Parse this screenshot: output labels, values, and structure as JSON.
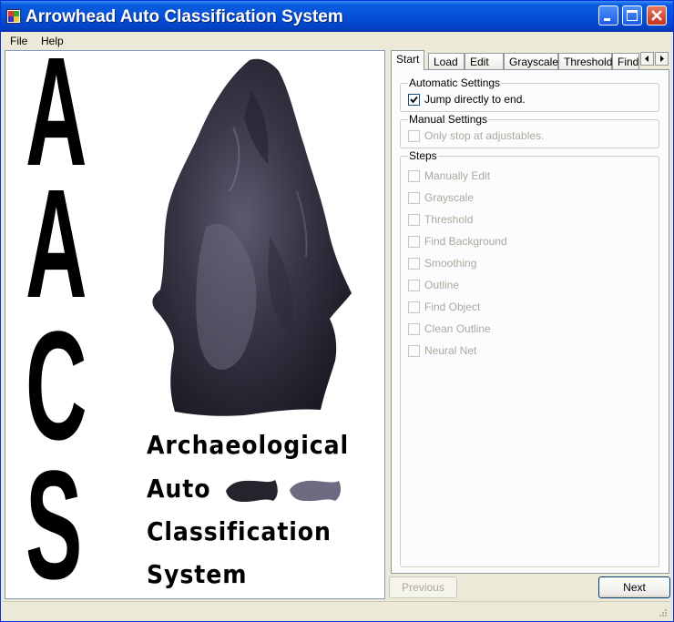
{
  "window": {
    "title": "Arrowhead Auto Classification System",
    "accent": "#0a5de0"
  },
  "menu": {
    "items": [
      {
        "label": "File"
      },
      {
        "label": "Help"
      }
    ]
  },
  "logo": {
    "letters": [
      "A",
      "A",
      "C",
      "S"
    ],
    "lines": [
      "Archaeological",
      "Auto",
      "Classification",
      "System"
    ]
  },
  "tabs": [
    {
      "label": "Start",
      "active": true
    },
    {
      "label": "Load"
    },
    {
      "label": "Edit"
    },
    {
      "label": "Grayscale"
    },
    {
      "label": "Threshold"
    },
    {
      "label": "Find"
    }
  ],
  "automatic": {
    "title": "Automatic Settings",
    "jump_label": "Jump directly to end.",
    "jump_checked": true
  },
  "manual": {
    "title": "Manual Settings",
    "stop_label": "Only stop at adjustables."
  },
  "steps": {
    "title": "Steps",
    "items": [
      "Manually Edit",
      "Grayscale",
      "Threshold",
      "Find Background",
      "Smoothing",
      "Outline",
      "Find Object",
      "Clean Outline",
      "Neural Net"
    ]
  },
  "buttons": {
    "previous": "Previous",
    "next": "Next"
  }
}
